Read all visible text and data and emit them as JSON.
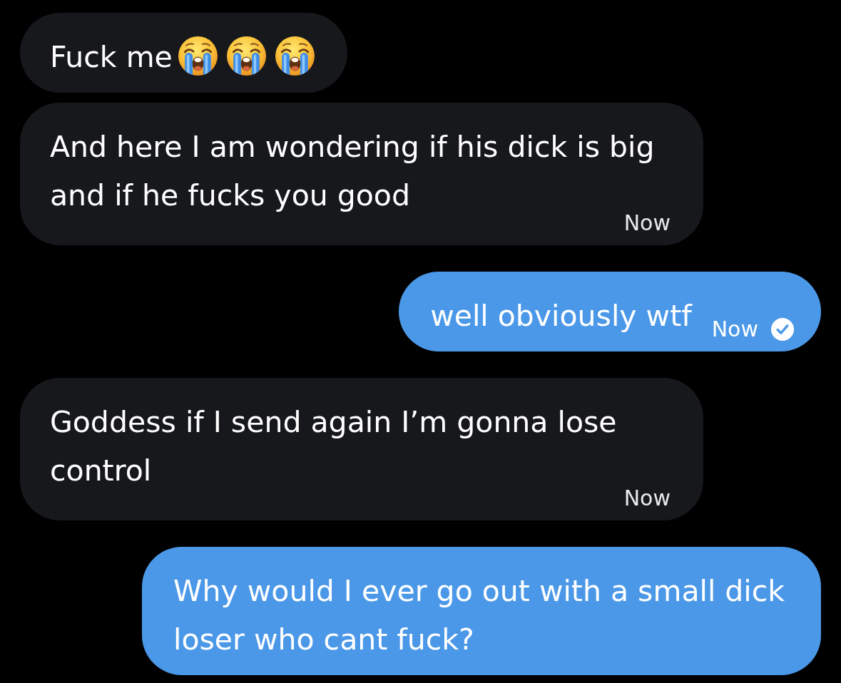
{
  "messages": [
    {
      "kind": "incoming",
      "text": "Fuck me",
      "emoji": [
        {
          "kind": "loudly-crying"
        },
        {
          "kind": "loudly-crying"
        },
        {
          "kind": "loudly-crying"
        }
      ],
      "seen": false
    },
    {
      "kind": "incoming",
      "text": "And here I am wondering if his dick is big and if he fucks you good",
      "time": "Now",
      "seen": false
    },
    {
      "kind": "outgoing",
      "text": "well obviously wtf",
      "time": "Now",
      "seen": true
    },
    {
      "kind": "incoming",
      "text": "Goddess if I send again I’m gonna lose control",
      "time": "Now",
      "seen": false
    },
    {
      "kind": "outgoing",
      "text": "Why would I ever go out with a small dick loser who cant fuck?",
      "seen": false
    }
  ]
}
